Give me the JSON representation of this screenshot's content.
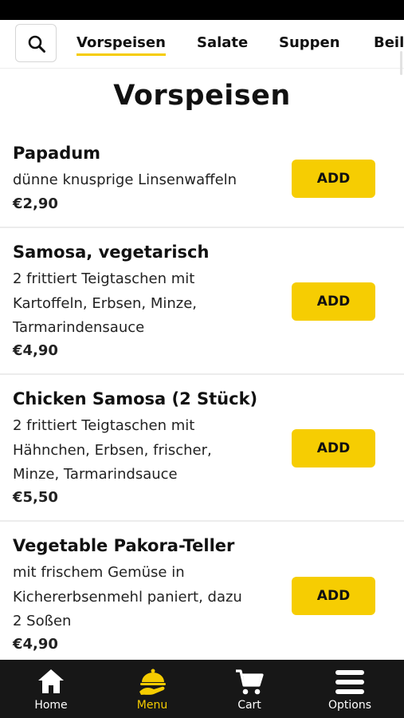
{
  "categories": [
    {
      "label": "Vorspeisen",
      "active": true
    },
    {
      "label": "Salate",
      "active": false
    },
    {
      "label": "Suppen",
      "active": false
    },
    {
      "label": "Beilagen",
      "active": false
    }
  ],
  "page_title": "Vorspeisen",
  "items": [
    {
      "name": "Papadum",
      "desc_lines": [
        "dünne knusprige Linsenwaffeln"
      ],
      "price": "€2,90",
      "add_label": "ADD"
    },
    {
      "name": "Samosa, vegetarisch",
      "desc_lines": [
        "2 frittiert Teigtaschen mit",
        "Kartoffeln, Erbsen, Minze,",
        "Tarmarindensauce"
      ],
      "price": "€4,90",
      "add_label": "ADD"
    },
    {
      "name": "Chicken Samosa (2 Stück)",
      "desc_lines": [
        "2 frittiert Teigtaschen mit",
        "Hähnchen, Erbsen, frischer,",
        "Minze, Tarmarindsauce"
      ],
      "price": "€5,50",
      "add_label": "ADD"
    },
    {
      "name": "Vegetable Pakora-Teller",
      "desc_lines": [
        "mit frischem Gemüse in",
        "Kichererbsenmehl paniert, dazu",
        "2 Soßen"
      ],
      "price": "€4,90",
      "add_label": "ADD"
    }
  ],
  "nav": [
    {
      "label": "Home",
      "icon": "home-icon",
      "active": false
    },
    {
      "label": "Menu",
      "icon": "cloche-icon",
      "active": true
    },
    {
      "label": "Cart",
      "icon": "cart-icon",
      "active": false
    },
    {
      "label": "Options",
      "icon": "menu-lines-icon",
      "active": false
    }
  ],
  "colors": {
    "accent": "#f6cd02",
    "nav_bg": "#171717"
  }
}
